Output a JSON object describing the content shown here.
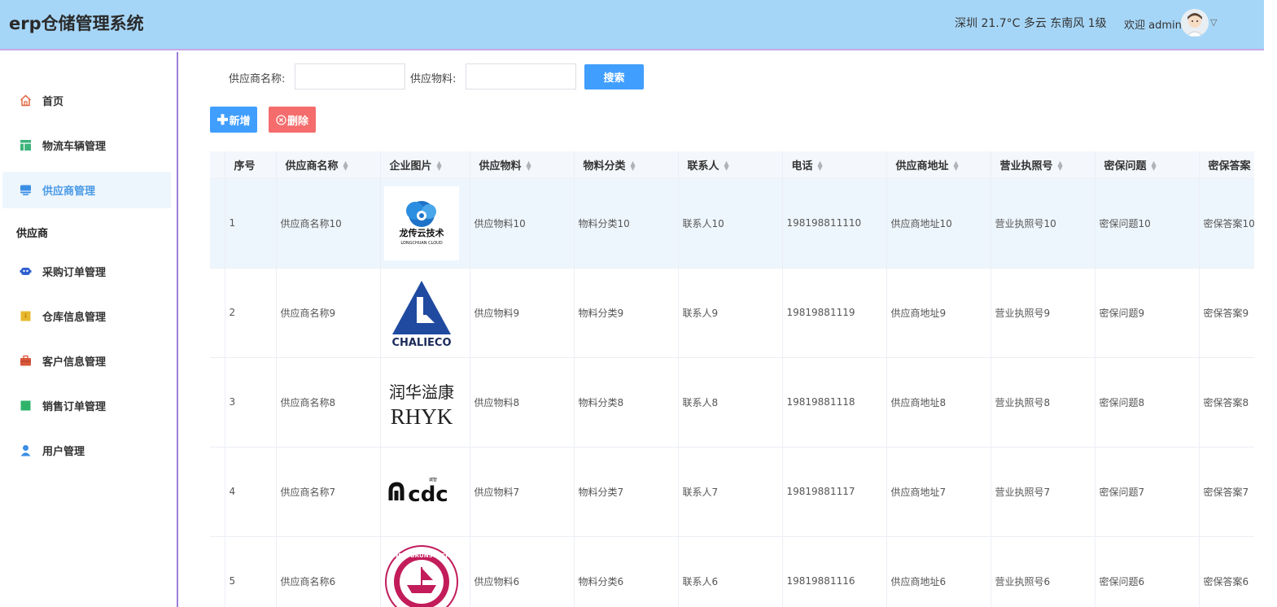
{
  "header": {
    "app_title": "erp仓储管理系统",
    "weather": "深圳 21.7°C 多云 东南风 1级",
    "welcome": "欢迎 admin"
  },
  "sidebar": {
    "items": [
      {
        "label": "首页",
        "icon": "home-icon",
        "color": "#e0603a"
      },
      {
        "label": "物流车辆管理",
        "icon": "table-icon",
        "color": "#3db37a"
      },
      {
        "label": "供应商管理",
        "icon": "monitor-icon",
        "color": "#3a8ee6",
        "active": true
      }
    ],
    "section_label": "供应商",
    "sub_items": [
      {
        "label": "采购订单管理",
        "icon": "robot-icon",
        "color": "#2f5fd0"
      },
      {
        "label": "仓库信息管理",
        "icon": "warehouse-icon",
        "color": "#e8b92e"
      },
      {
        "label": "客户信息管理",
        "icon": "briefcase-icon",
        "color": "#d9573a"
      },
      {
        "label": "销售订单管理",
        "icon": "square-icon",
        "color": "#2fb36b"
      },
      {
        "label": "用户管理",
        "icon": "user-icon",
        "color": "#3a8ee6"
      }
    ]
  },
  "search": {
    "supplier_label": "供应商名称:",
    "material_label": "供应物料:",
    "supplier_value": "",
    "material_value": "",
    "search_button": "搜索"
  },
  "actions": {
    "add_label": "新增",
    "delete_label": "删除"
  },
  "table": {
    "columns": [
      "序号",
      "供应商名称",
      "企业图片",
      "供应物料",
      "物料分类",
      "联系人",
      "电话",
      "供应商地址",
      "营业执照号",
      "密保问题",
      "密保答案"
    ],
    "rows": [
      {
        "no": "1",
        "name": "供应商名称10",
        "logo": "longchuan-cloud-logo",
        "logo_text": "龙传云技术",
        "logo_sub": "LONGCHUAN CLOUD",
        "material": "供应物料10",
        "category": "物料分类10",
        "contact": "联系人10",
        "phone": "198198811110",
        "address": "供应商地址10",
        "license": "营业执照号10",
        "question": "密保问题10",
        "answer": "密保答案10"
      },
      {
        "no": "2",
        "name": "供应商名称9",
        "logo": "chalieco-logo",
        "logo_text": "CHALIECO",
        "material": "供应物料9",
        "category": "物料分类9",
        "contact": "联系人9",
        "phone": "19819881119",
        "address": "供应商地址9",
        "license": "营业执照号9",
        "question": "密保问题9",
        "answer": "密保答案9"
      },
      {
        "no": "3",
        "name": "供应商名称8",
        "logo": "rhyk-logo",
        "logo_text": "润华溢康",
        "logo_sub": "RHYK",
        "material": "供应物料8",
        "category": "物料分类8",
        "contact": "联系人8",
        "phone": "19819881118",
        "address": "供应商地址8",
        "license": "营业执照号8",
        "question": "密保问题8",
        "answer": "密保答案8"
      },
      {
        "no": "4",
        "name": "供应商名称7",
        "logo": "cdc-logo",
        "logo_text": "cdc",
        "material": "供应物料7",
        "category": "物料分类7",
        "contact": "联系人7",
        "phone": "19819881117",
        "address": "供应商地址7",
        "license": "营业执照号7",
        "question": "密保问题7",
        "answer": "密保答案7"
      },
      {
        "no": "5",
        "name": "供应商名称6",
        "logo": "new-brunswick-logo",
        "logo_text": "NEW BRUNSWICK",
        "material": "供应物料6",
        "category": "物料分类6",
        "contact": "联系人6",
        "phone": "19819881116",
        "address": "供应商地址6",
        "license": "营业执照号6",
        "question": "密保问题6",
        "answer": "密保答案6"
      }
    ]
  }
}
